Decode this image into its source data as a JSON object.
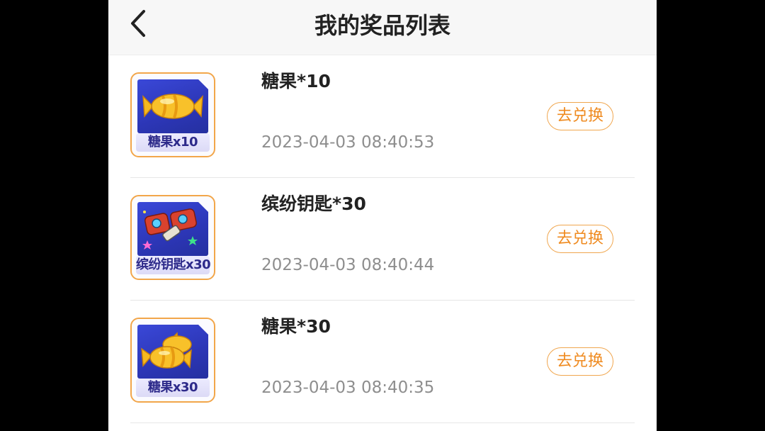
{
  "header": {
    "title": "我的奖品列表",
    "back_icon": "chevron-left-icon"
  },
  "prizes": [
    {
      "name": "糖果*10",
      "time": "2023-04-03 08:40:53",
      "button": "去兑换",
      "thumb_caption": "糖果x10",
      "icon": "candy-icon"
    },
    {
      "name": "缤纷钥匙*30",
      "time": "2023-04-03 08:40:44",
      "button": "去兑换",
      "thumb_caption": "缤纷钥匙x30",
      "icon": "key-icon"
    },
    {
      "name": "糖果*30",
      "time": "2023-04-03 08:40:35",
      "button": "去兑换",
      "thumb_caption": "糖果x30",
      "icon": "candies-icon"
    }
  ],
  "colors": {
    "accent": "#ef8a1f",
    "thumb_bg": "#3a48d8",
    "candy": "#f5b21e"
  }
}
